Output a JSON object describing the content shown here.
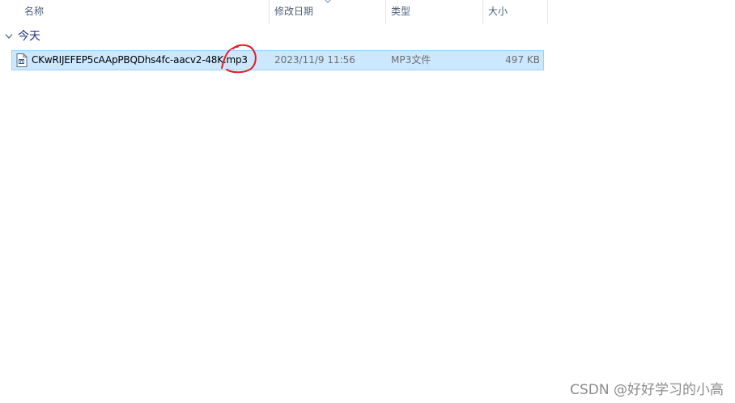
{
  "columns": {
    "name": "名称",
    "date_modified": "修改日期",
    "type": "类型",
    "size": "大小"
  },
  "group": {
    "label": "今天",
    "icon": "chevron-down-icon"
  },
  "files": [
    {
      "name": "CKwRIJEFEP5cAApPBQDhs4fc-aacv2-48K.mp3",
      "date_modified": "2023/11/9 11:56",
      "type": "MP3文件",
      "size": "497 KB",
      "icon": "audio-file-icon",
      "selected": true
    }
  ],
  "colors": {
    "selection_bg": "#cce8ff",
    "selection_border": "#99d1ff",
    "annotation": "#e8191b",
    "group_label": "#1e3287",
    "header_text": "#4c607a"
  },
  "watermark": "CSDN @好好学习的小高"
}
